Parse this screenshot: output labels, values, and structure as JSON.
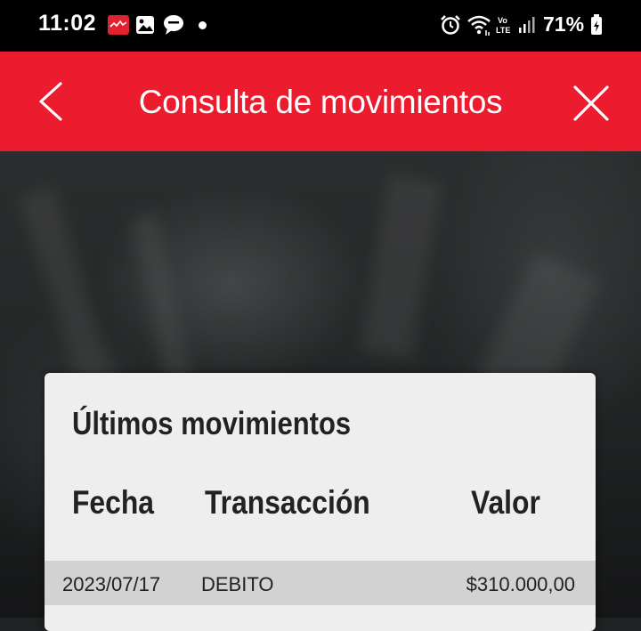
{
  "status_bar": {
    "time": "11:02",
    "battery_percent": "71%",
    "icons": [
      "app-notification-icon",
      "image-icon",
      "message-icon",
      "alarm-icon",
      "wifi-icon",
      "volte-icon",
      "signal-icon",
      "battery-icon"
    ]
  },
  "header": {
    "title": "Consulta de movimientos",
    "background_color": "#ec1b2e",
    "back_icon": "chevron-left-icon",
    "close_icon": "close-icon"
  },
  "card": {
    "title": "Últimos movimientos",
    "columns": [
      "Fecha",
      "Transacción",
      "Valor"
    ],
    "rows": [
      {
        "fecha": "2023/07/17",
        "transaccion": "DEBITO",
        "valor": "$310.000,00"
      }
    ]
  }
}
